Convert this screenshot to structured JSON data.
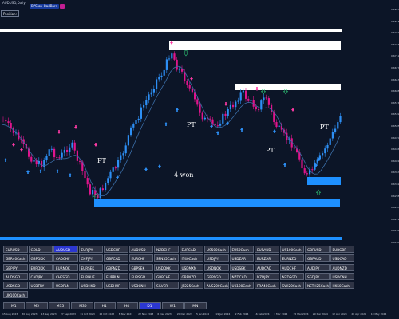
{
  "window": {
    "title": "AUDUSD,Daily"
  },
  "position_field": {
    "label": "Position:"
  },
  "toggles": [
    {
      "label": "BPS on"
    },
    {
      "label": "BadBars"
    },
    {
      "label": ""
    }
  ],
  "colors": {
    "background": "#0c1527",
    "bull": "#2d8ff5",
    "bear": "#e0148c",
    "zone": "#ffffff",
    "support_zone": "#1e90ff",
    "ma": "#3b6ea8"
  },
  "price_axis": [
    "0.68500",
    "0.68155",
    "0.67810",
    "0.67465",
    "0.67120",
    "0.66775",
    "0.66430",
    "0.66085",
    "0.65740",
    "0.65395",
    "0.65050",
    "0.64705",
    "0.64360",
    "0.64015",
    "0.63670",
    "0.63325",
    "0.62980",
    "0.62635",
    "0.62290",
    "0.61945",
    "0.61600"
  ],
  "time_axis": [
    "15 Aug 2023",
    "30 Aug 2023",
    "13 Sep 2023",
    "27 Sep 2023",
    "11 Oct 2023",
    "25 Oct 2023",
    "8 Nov 2023",
    "22 Nov 2023",
    "6 Dec 2023",
    "20 Dec 2023",
    "5 Jan 2024",
    "19 Jan 2024",
    "2 Feb 2024",
    "16 Feb 2024",
    "1 Mar 2024",
    "15 Mar 2024",
    "29 Mar 2024",
    "12 Apr 2024",
    "26 Apr 2024",
    "10 May 2024"
  ],
  "annotations": {
    "pt_label": "PT",
    "won_text": "4 won"
  },
  "symbols": [
    [
      "EURUSD",
      "GOLD",
      "AUDUSD",
      "EURJPY",
      "USDCHF",
      "AUDUSD",
      "NZDCHF",
      "EURCAD",
      "US500Cash",
      "EU50Cash",
      "EURAUD",
      "US100Cash",
      "GBPUSD",
      "EURGBP"
    ],
    [
      "GER40Cash",
      "GBPDKK",
      "CADCHF",
      "CHFJPY",
      "GBPCAD",
      "EURCHF",
      "SPN35Cash",
      "IT40Cash",
      "USDJPY",
      "USDZAR",
      "EURZAR",
      "EURNZD",
      "GBPAUD",
      "USDCAD"
    ],
    [
      "GBPJPY",
      "EURDKK",
      "EURNOK",
      "EURSEK",
      "GBPNZD",
      "GBPSEK",
      "USDDKK",
      "USDMXN",
      "USDNOK",
      "USDSEK",
      "AUDCAD",
      "AUDCHF",
      "AUDJPY",
      "AUDNZD"
    ],
    [
      "AUDSGD",
      "CADJPY",
      "CHFSGD",
      "EURHUF",
      "EURPLN",
      "EURSGD",
      "GBPCHF",
      "GBPNZD",
      "GBPSGD",
      "NZDCAD",
      "NZDJPY",
      "NZDSGD",
      "SGDJPY",
      "USDCNH"
    ],
    [
      "USDSGD",
      "USDTRY",
      "USDPLN",
      "USDHKD",
      "USDHUF",
      "USDCNH",
      "SILVER",
      "JP225Cash",
      "AUS200Cash",
      "UK100Cash",
      "FRA40Cash",
      "SWI20Cash",
      "NETH25Cash",
      "HK50Cash"
    ],
    [
      "UK100Cash"
    ]
  ],
  "active_symbol": "AUDUSD",
  "timeframes": [
    "M1",
    "M5",
    "M15",
    "M30",
    "H1",
    "H4",
    "D1",
    "W1",
    "MN"
  ],
  "active_timeframe": "D1"
}
